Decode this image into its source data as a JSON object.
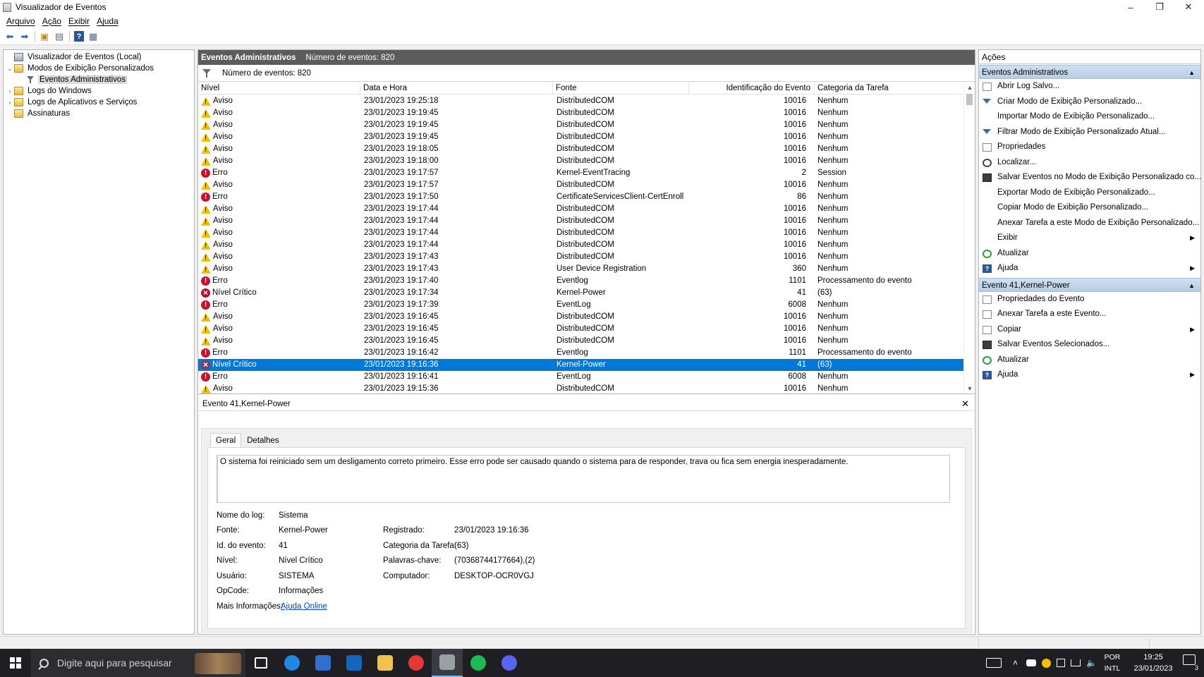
{
  "window": {
    "title": "Visualizador de Eventos",
    "controls": {
      "minimize": "–",
      "maximize": "❐",
      "close": "✕"
    }
  },
  "menu": [
    "Arquivo",
    "Ação",
    "Exibir",
    "Ajuda"
  ],
  "toolbar": {
    "icons": [
      "back-arrow-icon",
      "forward-arrow-icon",
      "folder-up-icon",
      "console-tree-icon",
      "help-icon",
      "properties-pane-icon"
    ],
    "glyphs": {
      "back": "⬅",
      "forward": "➡",
      "up": "▣",
      "tree": "▤",
      "help": "?",
      "pane": "▦"
    }
  },
  "tree": {
    "items": [
      {
        "label": "Visualizador de Eventos (Local)",
        "indent": 0,
        "expander": "",
        "icon": "computer-icon"
      },
      {
        "label": "Modos de Exibição Personalizados",
        "indent": 0,
        "expander": "⌄",
        "icon": "folder-icon"
      },
      {
        "label": "Eventos Administrativos",
        "indent": 1,
        "expander": "",
        "icon": "filter-icon",
        "selected": true
      },
      {
        "label": "Logs do Windows",
        "indent": 0,
        "expander": "›",
        "icon": "folder-icon"
      },
      {
        "label": "Logs de Aplicativos e Serviços",
        "indent": 0,
        "expander": "›",
        "icon": "folder-icon"
      },
      {
        "label": "Assinaturas",
        "indent": 0,
        "expander": "",
        "icon": "folder-icon"
      }
    ]
  },
  "center": {
    "header_title": "Eventos Administrativos",
    "header_count": "Número de eventos: 820",
    "filter_text": "Número de eventos: 820",
    "columns": [
      "Nível",
      "Data e Hora",
      "Fonte",
      "Identificação do Evento",
      "Categoria da Tarefa"
    ],
    "rows": [
      {
        "level": "Aviso",
        "type": "warn",
        "datetime": "23/01/2023 19:25:18",
        "source": "DistributedCOM",
        "id": "10016",
        "category": "Nenhum"
      },
      {
        "level": "Aviso",
        "type": "warn",
        "datetime": "23/01/2023 19:19:45",
        "source": "DistributedCOM",
        "id": "10016",
        "category": "Nenhum"
      },
      {
        "level": "Aviso",
        "type": "warn",
        "datetime": "23/01/2023 19:19:45",
        "source": "DistributedCOM",
        "id": "10016",
        "category": "Nenhum"
      },
      {
        "level": "Aviso",
        "type": "warn",
        "datetime": "23/01/2023 19:19:45",
        "source": "DistributedCOM",
        "id": "10016",
        "category": "Nenhum"
      },
      {
        "level": "Aviso",
        "type": "warn",
        "datetime": "23/01/2023 19:18:05",
        "source": "DistributedCOM",
        "id": "10016",
        "category": "Nenhum"
      },
      {
        "level": "Aviso",
        "type": "warn",
        "datetime": "23/01/2023 19:18:00",
        "source": "DistributedCOM",
        "id": "10016",
        "category": "Nenhum"
      },
      {
        "level": "Erro",
        "type": "err",
        "datetime": "23/01/2023 19:17:57",
        "source": "Kernel-EventTracing",
        "id": "2",
        "category": "Session"
      },
      {
        "level": "Aviso",
        "type": "warn",
        "datetime": "23/01/2023 19:17:57",
        "source": "DistributedCOM",
        "id": "10016",
        "category": "Nenhum"
      },
      {
        "level": "Erro",
        "type": "err",
        "datetime": "23/01/2023 19:17:50",
        "source": "CertificateServicesClient-CertEnroll",
        "id": "86",
        "category": "Nenhum"
      },
      {
        "level": "Aviso",
        "type": "warn",
        "datetime": "23/01/2023 19:17:44",
        "source": "DistributedCOM",
        "id": "10016",
        "category": "Nenhum"
      },
      {
        "level": "Aviso",
        "type": "warn",
        "datetime": "23/01/2023 19:17:44",
        "source": "DistributedCOM",
        "id": "10016",
        "category": "Nenhum"
      },
      {
        "level": "Aviso",
        "type": "warn",
        "datetime": "23/01/2023 19:17:44",
        "source": "DistributedCOM",
        "id": "10016",
        "category": "Nenhum"
      },
      {
        "level": "Aviso",
        "type": "warn",
        "datetime": "23/01/2023 19:17:44",
        "source": "DistributedCOM",
        "id": "10016",
        "category": "Nenhum"
      },
      {
        "level": "Aviso",
        "type": "warn",
        "datetime": "23/01/2023 19:17:43",
        "source": "DistributedCOM",
        "id": "10016",
        "category": "Nenhum"
      },
      {
        "level": "Aviso",
        "type": "warn",
        "datetime": "23/01/2023 19:17:43",
        "source": "User Device Registration",
        "id": "360",
        "category": "Nenhum"
      },
      {
        "level": "Erro",
        "type": "err",
        "datetime": "23/01/2023 19:17:40",
        "source": "Eventlog",
        "id": "1101",
        "category": "Processamento do evento"
      },
      {
        "level": "Nível Crítico",
        "type": "crit",
        "datetime": "23/01/2023 19:17:34",
        "source": "Kernel-Power",
        "id": "41",
        "category": "(63)"
      },
      {
        "level": "Erro",
        "type": "err",
        "datetime": "23/01/2023 19:17:39",
        "source": "EventLog",
        "id": "6008",
        "category": "Nenhum"
      },
      {
        "level": "Aviso",
        "type": "warn",
        "datetime": "23/01/2023 19:16:45",
        "source": "DistributedCOM",
        "id": "10016",
        "category": "Nenhum"
      },
      {
        "level": "Aviso",
        "type": "warn",
        "datetime": "23/01/2023 19:16:45",
        "source": "DistributedCOM",
        "id": "10016",
        "category": "Nenhum"
      },
      {
        "level": "Aviso",
        "type": "warn",
        "datetime": "23/01/2023 19:16:45",
        "source": "DistributedCOM",
        "id": "10016",
        "category": "Nenhum"
      },
      {
        "level": "Erro",
        "type": "err",
        "datetime": "23/01/2023 19:16:42",
        "source": "Eventlog",
        "id": "1101",
        "category": "Processamento do evento"
      },
      {
        "level": "Nível Crítico",
        "type": "crit",
        "datetime": "23/01/2023 19:16:36",
        "source": "Kernel-Power",
        "id": "41",
        "category": "(63)",
        "selected": true
      },
      {
        "level": "Erro",
        "type": "err",
        "datetime": "23/01/2023 19:16:41",
        "source": "EventLog",
        "id": "6008",
        "category": "Nenhum"
      },
      {
        "level": "Aviso",
        "type": "warn",
        "datetime": "23/01/2023 19:15:36",
        "source": "DistributedCOM",
        "id": "10016",
        "category": "Nenhum"
      }
    ]
  },
  "details": {
    "title": "Evento 41,Kernel-Power",
    "close": "✕",
    "tabs": [
      "Geral",
      "Detalhes"
    ],
    "description": "O sistema foi reiniciado sem um desligamento correto primeiro. Esse erro pode ser causado quando o sistema para de responder, trava ou fica sem energia inesperadamente.",
    "labels": {
      "log_name": "Nome do log:",
      "source": "Fonte:",
      "event_id": "Id. do evento:",
      "level": "Nível:",
      "user": "Usuário:",
      "opcode": "OpCode:",
      "more_info": "Mais Informações:",
      "logged": "Registrado:",
      "task_category": "Categoria da Tarefa:",
      "keywords": "Palavras-chave:",
      "computer": "Computador:"
    },
    "values": {
      "log_name": "Sistema",
      "source": "Kernel-Power",
      "event_id": "41",
      "level": "Nível Crítico",
      "user": "SISTEMA",
      "opcode": "Informações",
      "more_info": "Ajuda Online",
      "logged": "23/01/2023 19:16:36",
      "task_category": "(63)",
      "keywords": "(70368744177664),(2)",
      "computer": "DESKTOP-OCR0VGJ"
    }
  },
  "actions": {
    "title": "Ações",
    "sections": [
      {
        "title": "Eventos Administrativos",
        "items": [
          {
            "label": "Abrir Log Salvo...",
            "icon": "open-log-icon"
          },
          {
            "label": "Criar Modo de Exibição Personalizado...",
            "icon": "create-view-icon"
          },
          {
            "label": "Importar Modo de Exibição Personalizado...",
            "icon": ""
          },
          {
            "label": "Filtrar Modo de Exibição Personalizado Atual...",
            "icon": "filter-icon"
          },
          {
            "label": "Propriedades",
            "icon": "properties-icon"
          },
          {
            "label": "Localizar...",
            "icon": "find-icon"
          },
          {
            "label": "Salvar Eventos no Modo de Exibição Personalizado co...",
            "icon": "save-icon"
          },
          {
            "label": "Exportar Modo de Exibição Personalizado...",
            "icon": ""
          },
          {
            "label": "Copiar Modo de Exibição Personalizado...",
            "icon": ""
          },
          {
            "label": "Anexar Tarefa a este Modo de Exibição Personalizado...",
            "icon": ""
          },
          {
            "label": "Exibir",
            "icon": "",
            "submenu": true
          },
          {
            "label": "Atualizar",
            "icon": "refresh-icon"
          },
          {
            "label": "Ajuda",
            "icon": "help-icon",
            "submenu": true
          }
        ]
      },
      {
        "title": "Evento 41,Kernel-Power",
        "items": [
          {
            "label": "Propriedades do Evento",
            "icon": "event-properties-icon"
          },
          {
            "label": "Anexar Tarefa a este Evento...",
            "icon": "attach-task-icon"
          },
          {
            "label": "Copiar",
            "icon": "copy-icon",
            "submenu": true
          },
          {
            "label": "Salvar Eventos Selecionados...",
            "icon": "save-icon"
          },
          {
            "label": "Atualizar",
            "icon": "refresh-icon"
          },
          {
            "label": "Ajuda",
            "icon": "help-icon",
            "submenu": true
          }
        ]
      }
    ]
  },
  "taskbar": {
    "search_placeholder": "Digite aqui para pesquisar",
    "apps": [
      {
        "name": "task-view-icon",
        "color": "#1f1f23"
      },
      {
        "name": "edge-icon",
        "color": "#1e88e5"
      },
      {
        "name": "store-icon",
        "color": "#2f6fd1"
      },
      {
        "name": "mail-icon",
        "color": "#1565c0"
      },
      {
        "name": "file-explorer-icon",
        "color": "#f2c14e"
      },
      {
        "name": "chrome-icon",
        "color": "#e53935"
      },
      {
        "name": "event-viewer-icon",
        "color": "#9aa0a6"
      },
      {
        "name": "spotify-icon",
        "color": "#1db954"
      },
      {
        "name": "discord-icon",
        "color": "#5865f2"
      }
    ],
    "ime_lang": "POR",
    "ime_layout": "INTL",
    "time": "19:25",
    "date": "23/01/2023",
    "notifications": "3"
  }
}
